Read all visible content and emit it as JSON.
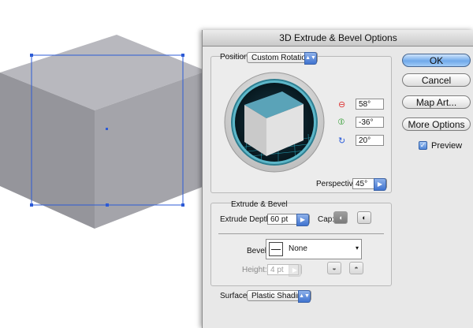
{
  "dialog": {
    "title": "3D Extrude & Bevel Options"
  },
  "position": {
    "label": "Position:",
    "value": "Custom Rotation"
  },
  "rotation": {
    "x_angle": "58°",
    "y_angle": "-36°",
    "z_angle": "20°"
  },
  "perspective": {
    "label": "Perspective:",
    "value": "45°"
  },
  "extrude_bevel": {
    "section_label": "Extrude & Bevel",
    "depth_label": "Extrude Depth:",
    "depth_value": "60 pt",
    "cap_label": "Cap:",
    "bevel_label": "Bevel:",
    "bevel_value": "None",
    "height_label": "Height:",
    "height_value": "4 pt"
  },
  "surface": {
    "label": "Surface:",
    "value": "Plastic Shading"
  },
  "buttons": {
    "ok": "OK",
    "cancel": "Cancel",
    "map_art": "Map Art...",
    "more_options": "More Options"
  },
  "preview": {
    "label": "Preview",
    "checked": true
  },
  "colors": {
    "cube_top": "#5aa3b8",
    "accent_blue": "#3f73cf",
    "selection": "#2d5bd6"
  }
}
